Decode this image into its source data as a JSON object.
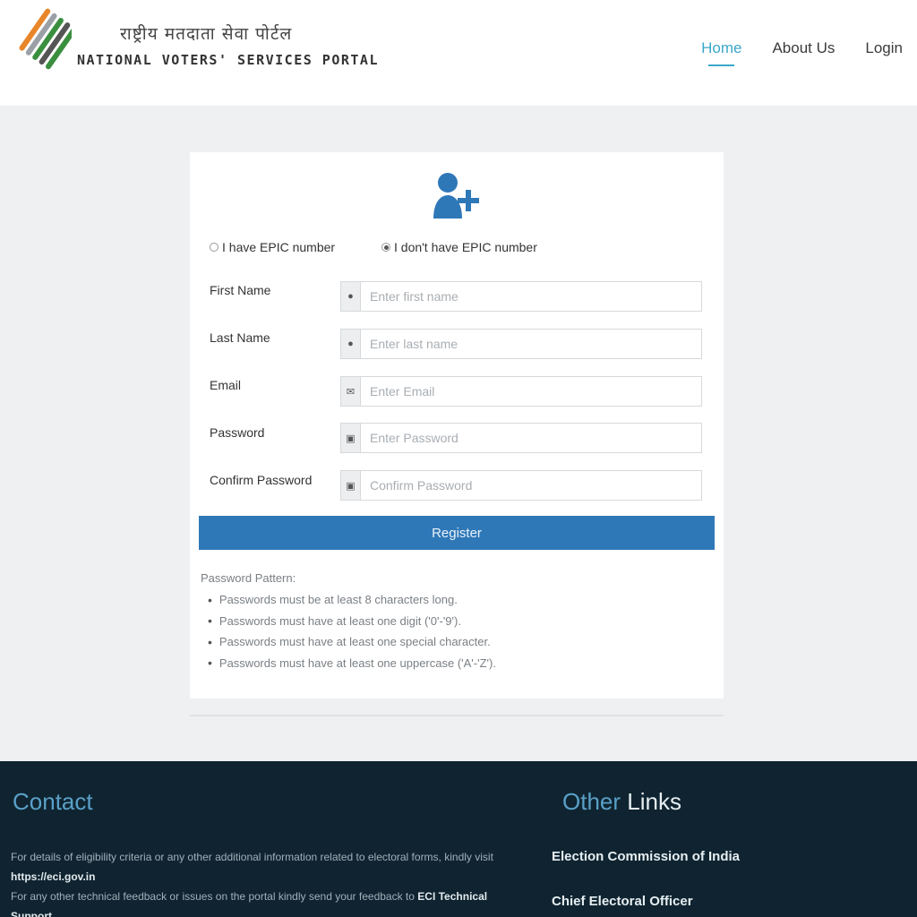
{
  "header": {
    "logo_hindi": "राष्ट्रीय मतदाता सेवा पोर्टल",
    "logo_english": "NATIONAL VOTERS' SERVICES PORTAL",
    "nav": [
      {
        "label": "Home",
        "active": true
      },
      {
        "label": "About Us",
        "active": false
      },
      {
        "label": "Login",
        "active": false
      }
    ]
  },
  "form": {
    "icon": "add-user-icon",
    "radio_have_epic": "I have EPIC number",
    "radio_no_epic": "I don't have EPIC number",
    "selected_radio": "no_epic",
    "fields": [
      {
        "label": "First Name",
        "placeholder": "Enter first name",
        "icon": "user-icon"
      },
      {
        "label": "Last Name",
        "placeholder": "Enter last name",
        "icon": "user-icon"
      },
      {
        "label": "Email",
        "placeholder": "Enter Email",
        "icon": "envelope-icon"
      },
      {
        "label": "Password",
        "placeholder": "Enter Password",
        "icon": "lock-icon"
      },
      {
        "label": "Confirm Password",
        "placeholder": "Confirm Password",
        "icon": "lock-icon"
      }
    ],
    "register_label": "Register",
    "pw_title": "Password Pattern:",
    "pw_rules": [
      "Passwords must be at least 8 characters long.",
      "Passwords must have at least one digit ('0'-'9').",
      "Passwords must have at least one special character.",
      "Passwords must have at least one uppercase ('A'-'Z')."
    ]
  },
  "footer": {
    "contact_title": "Contact",
    "contact_line1": "For details of eligibility criteria or any other additional information related to electoral forms, kindly visit",
    "contact_link": "https://eci.gov.in",
    "contact_line2_pre": "For any other technical feedback or issues on the portal kindly send your feedback to",
    "contact_line2_bold": "ECI Technical Support",
    "links_title_a": "Other",
    "links_title_b": "Links",
    "links": [
      "Election Commission of India",
      "Chief Electoral Officer"
    ]
  },
  "colors": {
    "accent": "#3aa7c9",
    "button": "#2f78b8",
    "footer_bg": "#0f2430"
  }
}
